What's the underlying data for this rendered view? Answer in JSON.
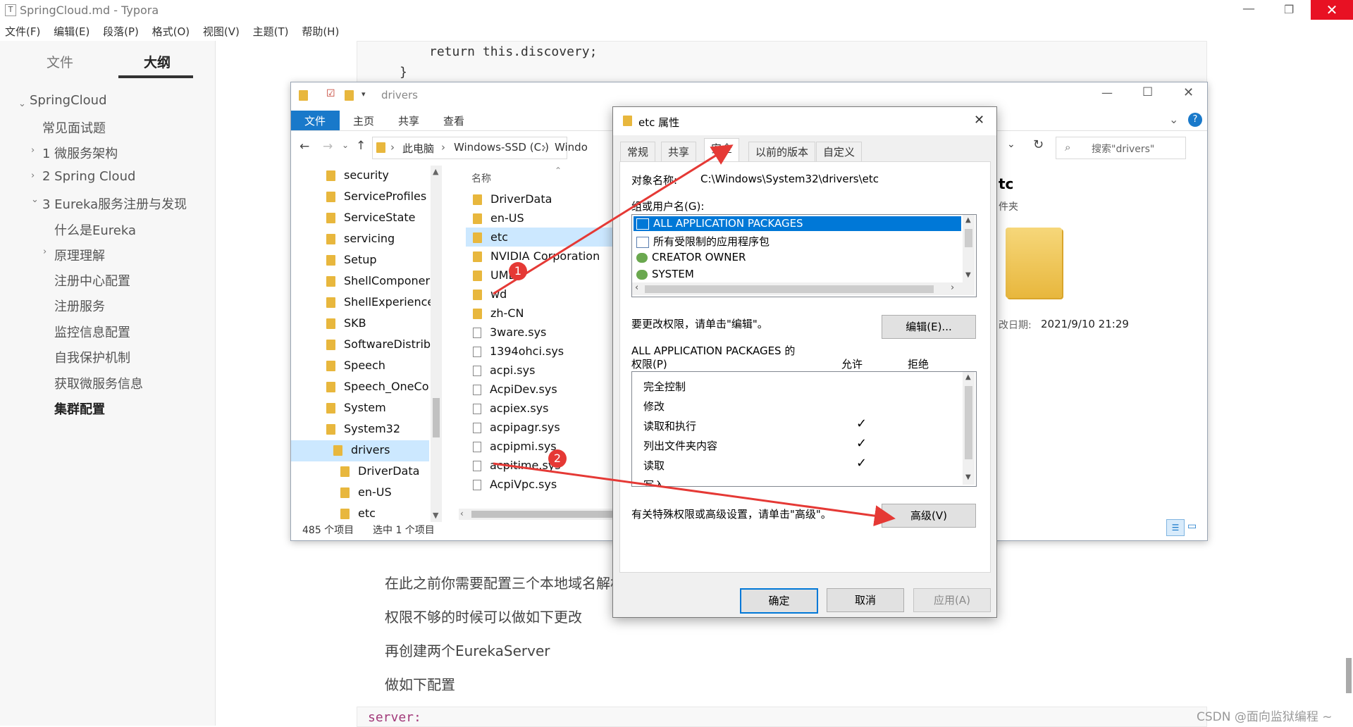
{
  "app": {
    "title": "SpringCloud.md - Typora"
  },
  "menu": [
    "文件(F)",
    "编辑(E)",
    "段落(P)",
    "格式(O)",
    "视图(V)",
    "主题(T)",
    "帮助(H)"
  ],
  "sidebar": {
    "tabs": [
      "文件",
      "大纲"
    ],
    "outline": [
      {
        "label": "SpringCloud"
      },
      {
        "label": "常见面试题"
      },
      {
        "label": "1 微服务架构"
      },
      {
        "label": "2 Spring Cloud"
      },
      {
        "label": "3 Eureka服务注册与发现"
      },
      {
        "label": "什么是Eureka"
      },
      {
        "label": "原理理解"
      },
      {
        "label": "注册中心配置"
      },
      {
        "label": "注册服务"
      },
      {
        "label": "监控信息配置"
      },
      {
        "label": "自我保护机制"
      },
      {
        "label": "获取微服务信息"
      },
      {
        "label": "集群配置"
      }
    ]
  },
  "editor": {
    "code_top": {
      "line1": "return this.discovery;",
      "line2": "}"
    },
    "paragraphs": [
      "在此之前你需要配置三个本地域名解析",
      "权限不够的时候可以做如下更改",
      "再创建两个EurekaServer",
      "做如下配置"
    ],
    "code_bottom": "server:"
  },
  "explorer": {
    "title": "drivers",
    "ribbon": [
      "文件",
      "主页",
      "共享",
      "查看"
    ],
    "address": [
      "此电脑",
      "Windows-SSD (C:)",
      "Windo"
    ],
    "search_placeholder": "搜索\"drivers\"",
    "nav_tree": [
      "security",
      "ServiceProfiles",
      "ServiceState",
      "servicing",
      "Setup",
      "ShellComponer",
      "ShellExperience",
      "SKB",
      "SoftwareDistrib",
      "Speech",
      "Speech_OneCo",
      "System",
      "System32",
      "drivers",
      "DriverData",
      "en-US",
      "etc"
    ],
    "column_header": "名称",
    "files": [
      {
        "name": "DriverData",
        "type": "folder"
      },
      {
        "name": "en-US",
        "type": "folder"
      },
      {
        "name": "etc",
        "type": "folder"
      },
      {
        "name": "NVIDIA Corporation",
        "type": "folder"
      },
      {
        "name": "UMDF",
        "type": "folder"
      },
      {
        "name": "wd",
        "type": "folder"
      },
      {
        "name": "zh-CN",
        "type": "folder"
      },
      {
        "name": "3ware.sys",
        "type": "file"
      },
      {
        "name": "1394ohci.sys",
        "type": "file"
      },
      {
        "name": "acpi.sys",
        "type": "file"
      },
      {
        "name": "AcpiDev.sys",
        "type": "file"
      },
      {
        "name": "acpiex.sys",
        "type": "file"
      },
      {
        "name": "acpipagr.sys",
        "type": "file"
      },
      {
        "name": "acpipmi.sys",
        "type": "file"
      },
      {
        "name": "acpitime.sys",
        "type": "file"
      },
      {
        "name": "AcpiVpc.sys",
        "type": "file"
      }
    ],
    "status_count": "485 个项目",
    "status_selected": "选中 1 个项目",
    "preview": {
      "name": "tc",
      "type": "件夹",
      "modified_label": "改日期:",
      "modified_value": "2021/9/10 21:29"
    }
  },
  "dialog": {
    "title": "etc 属性",
    "tabs": [
      "常规",
      "共享",
      "安全",
      "以前的版本",
      "自定义"
    ],
    "object_label": "对象名称:",
    "object_value": "C:\\Windows\\System32\\drivers\\etc",
    "group_label": "组或用户名(G):",
    "groups": [
      "ALL APPLICATION PACKAGES",
      "所有受限制的应用程序包",
      "CREATOR OWNER",
      "SYSTEM"
    ],
    "edit_hint": "要更改权限，请单击\"编辑\"。",
    "edit_button": "编辑(E)...",
    "perm_title_line1": "ALL APPLICATION PACKAGES 的",
    "perm_title_line2": "权限(P)",
    "allow_label": "允许",
    "deny_label": "拒绝",
    "permissions": [
      {
        "name": "完全控制",
        "allow": ""
      },
      {
        "name": "修改",
        "allow": ""
      },
      {
        "name": "读取和执行",
        "allow": "✓"
      },
      {
        "name": "列出文件夹内容",
        "allow": "✓"
      },
      {
        "name": "读取",
        "allow": "✓"
      },
      {
        "name": "写入",
        "allow": ""
      }
    ],
    "advanced_hint": "有关特殊权限或高级设置，请单击\"高级\"。",
    "advanced_button": "高级(V)",
    "ok_button": "确定",
    "cancel_button": "取消",
    "apply_button": "应用(A)"
  },
  "annotations": {
    "badge1": "1",
    "badge2": "2"
  },
  "watermark": "CSDN @面向监狱编程 ~",
  "colors": {
    "selection": "#0078d7",
    "annotation": "#e53935",
    "folder": "#e8b73d",
    "ribbon_active": "#1979ca"
  }
}
